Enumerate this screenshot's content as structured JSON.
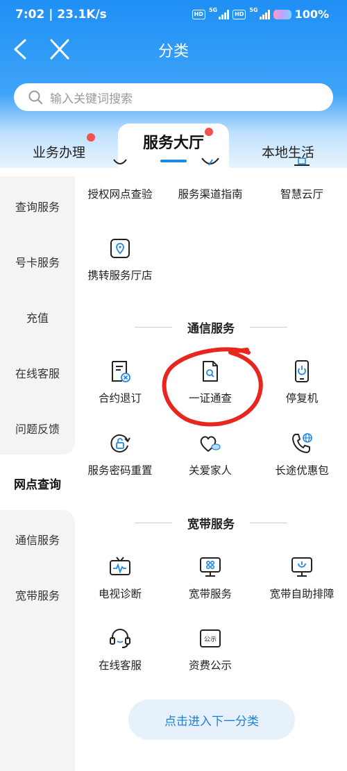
{
  "status_bar": {
    "time": "7:02 | 23.1K/s",
    "hd_1": "HD",
    "net_1": "5G",
    "hd_2": "HD",
    "net_2": "5G",
    "battery": "100%"
  },
  "nav": {
    "title": "分类"
  },
  "search": {
    "placeholder": "输入关键词搜索"
  },
  "tabs": [
    {
      "label": "业务办理",
      "badge": true
    },
    {
      "label": "服务大厅",
      "badge": true,
      "active": true
    },
    {
      "label": "本地生活",
      "badge": false
    }
  ],
  "sidebar": {
    "items": [
      {
        "label": "查询服务"
      },
      {
        "label": "号卡服务"
      },
      {
        "label": "充值"
      },
      {
        "label": "在线客服"
      },
      {
        "label": "问题反馈"
      },
      {
        "label": "网点查询",
        "active": true
      },
      {
        "label": "通信服务"
      },
      {
        "label": "宽带服务"
      }
    ]
  },
  "content": {
    "top_row": [
      {
        "label": "授权网点查验",
        "icon": "outlet-check-icon"
      },
      {
        "label": "服务渠道指南",
        "icon": "compass-icon"
      },
      {
        "label": "智慧云厅",
        "icon": "cloud-hall-icon"
      }
    ],
    "network_point_extra": [
      {
        "label": "携转服务厅店",
        "icon": "location-store-icon"
      }
    ],
    "comm_section": {
      "title": "通信服务",
      "items": [
        {
          "label": "合约退订",
          "icon": "contract-cancel-icon"
        },
        {
          "label": "一证通查",
          "icon": "id-check-icon"
        },
        {
          "label": "停复机",
          "icon": "phone-power-icon"
        },
        {
          "label": "服务密码重置",
          "icon": "password-reset-icon"
        },
        {
          "label": "关爱家人",
          "icon": "family-heart-icon"
        },
        {
          "label": "长途优惠包",
          "icon": "long-distance-icon"
        }
      ]
    },
    "broadband_section": {
      "title": "宽带服务",
      "items": [
        {
          "label": "电视诊断",
          "icon": "tv-diagnosis-icon"
        },
        {
          "label": "宽带服务",
          "icon": "broadband-service-icon"
        },
        {
          "label": "宽带自助排障",
          "icon": "broadband-repair-icon"
        },
        {
          "label": "在线客服",
          "icon": "headset-icon"
        },
        {
          "label": "资费公示",
          "icon": "tariff-notice-icon"
        }
      ],
      "tariff_icon_text": "公示"
    },
    "next_button": "点击进入下一分类"
  },
  "colors": {
    "brand_blue": "#1e88e5",
    "badge_red": "#f2524d",
    "annotation_red": "#e8261f"
  }
}
